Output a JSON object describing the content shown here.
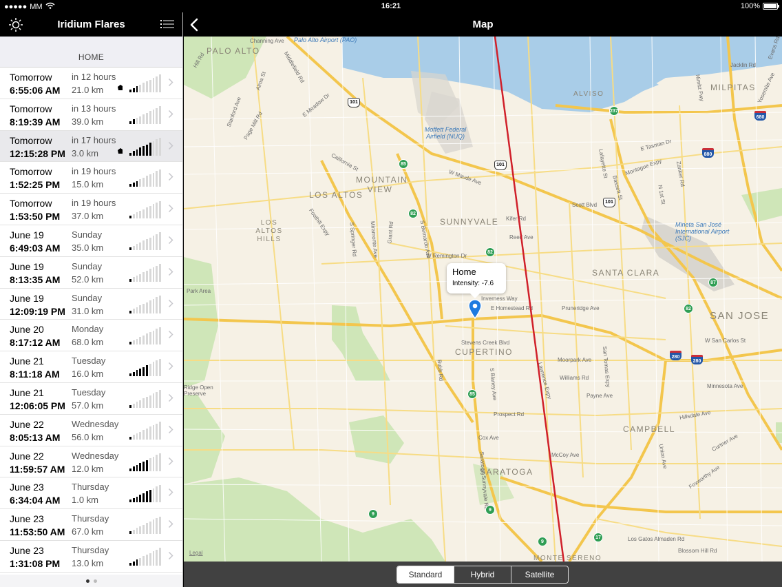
{
  "status_bar": {
    "carrier": "MM",
    "time": "16:21",
    "battery": "100%"
  },
  "sidebar": {
    "title": "Iridium Flares",
    "section_header": "HOME",
    "rows": [
      {
        "date": "Tomorrow",
        "time": "6:55:06 AM",
        "relative": "in 12 hours",
        "distance": "21.0 km",
        "signal": 3,
        "home": true,
        "selected": false
      },
      {
        "date": "Tomorrow",
        "time": "8:19:39 AM",
        "relative": "in 13 hours",
        "distance": "39.0 km",
        "signal": 2,
        "home": false,
        "selected": false
      },
      {
        "date": "Tomorrow",
        "time": "12:15:28 PM",
        "relative": "in 17 hours",
        "distance": "3.0 km",
        "signal": 7,
        "home": true,
        "selected": true
      },
      {
        "date": "Tomorrow",
        "time": "1:52:25 PM",
        "relative": "in 19 hours",
        "distance": "15.0 km",
        "signal": 3,
        "home": false,
        "selected": false
      },
      {
        "date": "Tomorrow",
        "time": "1:53:50 PM",
        "relative": "in 19 hours",
        "distance": "37.0 km",
        "signal": 1,
        "home": false,
        "selected": false
      },
      {
        "date": "June 19",
        "time": "6:49:03 AM",
        "relative": "Sunday",
        "distance": "35.0 km",
        "signal": 1,
        "home": false,
        "selected": false
      },
      {
        "date": "June 19",
        "time": "8:13:35 AM",
        "relative": "Sunday",
        "distance": "52.0 km",
        "signal": 1,
        "home": false,
        "selected": false
      },
      {
        "date": "June 19",
        "time": "12:09:19 PM",
        "relative": "Sunday",
        "distance": "31.0 km",
        "signal": 1,
        "home": false,
        "selected": false
      },
      {
        "date": "June 20",
        "time": "8:17:12 AM",
        "relative": "Monday",
        "distance": "68.0 km",
        "signal": 1,
        "home": false,
        "selected": false
      },
      {
        "date": "June 21",
        "time": "8:11:18 AM",
        "relative": "Tuesday",
        "distance": "16.0 km",
        "signal": 6,
        "home": false,
        "selected": false
      },
      {
        "date": "June 21",
        "time": "12:06:05 PM",
        "relative": "Tuesday",
        "distance": "57.0 km",
        "signal": 1,
        "home": false,
        "selected": false
      },
      {
        "date": "June 22",
        "time": "8:05:13 AM",
        "relative": "Wednesday",
        "distance": "56.0 km",
        "signal": 1,
        "home": false,
        "selected": false
      },
      {
        "date": "June 22",
        "time": "11:59:57 AM",
        "relative": "Wednesday",
        "distance": "12.0 km",
        "signal": 6,
        "home": false,
        "selected": false
      },
      {
        "date": "June 23",
        "time": "6:34:04 AM",
        "relative": "Thursday",
        "distance": "1.0 km",
        "signal": 7,
        "home": false,
        "selected": false
      },
      {
        "date": "June 23",
        "time": "11:53:50 AM",
        "relative": "Thursday",
        "distance": "67.0 km",
        "signal": 1,
        "home": false,
        "selected": false
      },
      {
        "date": "June 23",
        "time": "1:31:08 PM",
        "relative": "Thursday",
        "distance": "13.0 km",
        "signal": 3,
        "home": false,
        "selected": false
      }
    ],
    "page_dots": {
      "count": 2,
      "active": 0
    }
  },
  "map_panel": {
    "title": "Map",
    "callout": {
      "title": "Home",
      "subtitle": "Intensity: -7.6"
    },
    "legal": "Legal",
    "modes": [
      "Standard",
      "Hybrid",
      "Satellite"
    ],
    "active_mode": 0,
    "flare_track_color": "#d0202a",
    "pin_color": "#1e7be0",
    "labels": {
      "cities": [
        "PALO ALTO",
        "MOUNTAIN VIEW",
        "LOS ALTOS",
        "LOS ALTOS HILLS",
        "SUNNYVALE",
        "SANTA CLARA",
        "SAN JOSE",
        "CUPERTINO",
        "SARATOGA",
        "CAMPBELL",
        "MILPITAS",
        "ALVISO",
        "MONTE SERENO"
      ],
      "airports": [
        "Palo Alto Airport (PAO)",
        "Moffett Federal Airfield (NUQ)",
        "Mineta San José International Airport (SJC)"
      ],
      "streets": [
        "Channing Ave",
        "Middlefield Rd",
        "E Meadow Dr",
        "Page Mill Rd",
        "Stanford Ave",
        "Alma St",
        "California St",
        "W Maude Ave",
        "W Remington Dr",
        "Inverness Way",
        "E Homestead Rd",
        "Stevens Creek Blvd",
        "Pruneridge Ave",
        "Moorpark Ave",
        "Williams Rd",
        "Payne Ave",
        "Prospect Rd",
        "Cox Ave",
        "McCoy Ave",
        "Foothill Expy",
        "Lawrence Expy",
        "San Tomas Expy",
        "Kifer Rd",
        "Reed Ave",
        "Scott Blvd",
        "Montague Expy",
        "E Tasman Dr",
        "W San Carlos St",
        "Minnesota Ave",
        "Los Gatos Almaden Rd",
        "Blossom Hill Rd",
        "Bubb Rd",
        "Saratoga Sunnyvale Rd",
        "S Blaney Ave",
        "Grant Rd",
        "Miramonte Ave",
        "S Springer Rd",
        "S Bernardo Ave",
        "Lafayette St",
        "Bassett St",
        "N 1st St",
        "Zanker Rd",
        "Yosemite Ave",
        "Jacklin Rd",
        "Evans Rd",
        "Nimitz Fwy",
        "Ridge Open Preserve",
        "Park Area",
        "Hill Rd",
        "Curtner Ave",
        "Foxworthy Ave",
        "Union Ave",
        "Hillsdale Ave"
      ],
      "highways": [
        "101",
        "85",
        "82",
        "237",
        "280",
        "880",
        "680",
        "87",
        "17",
        "9"
      ]
    }
  }
}
